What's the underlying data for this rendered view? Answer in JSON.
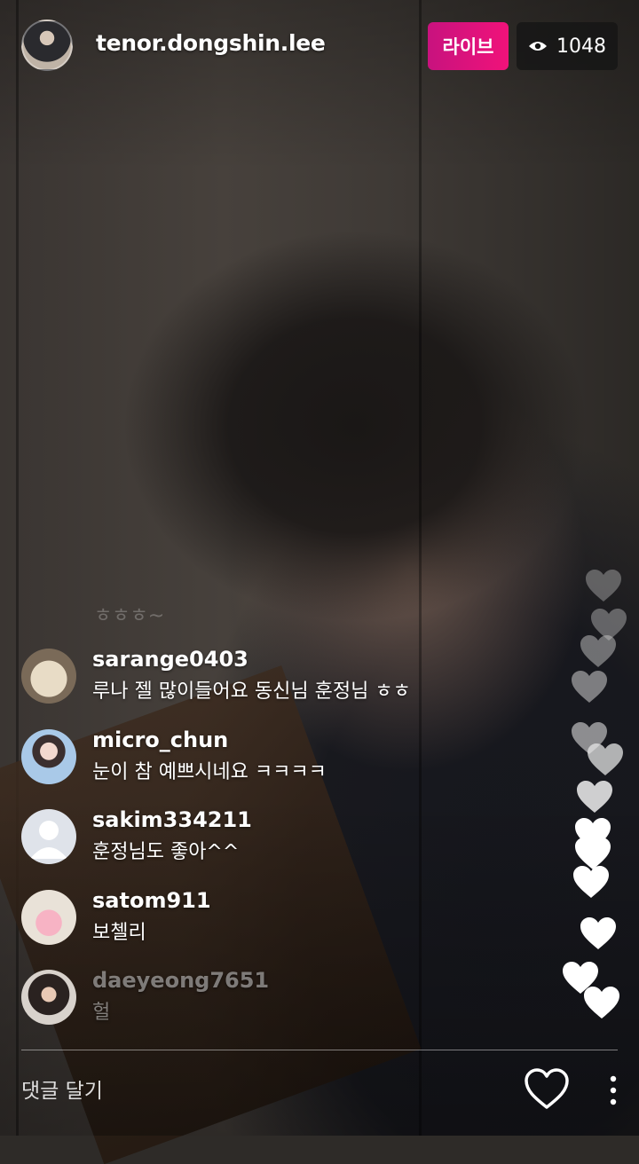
{
  "header": {
    "username": "tenor.dongshin.lee",
    "live_label": "라이브",
    "viewer_icon": "eye-icon",
    "viewer_count": "1048"
  },
  "faded_comment": "ㅎㅎㅎ~",
  "comments": [
    {
      "user": "sarange0403",
      "text": "루나 젤 많이들어요 동신님 훈정님 ㅎㅎ"
    },
    {
      "user": "micro_chun",
      "text": "눈이 참 예쁘시네요 ㅋㅋㅋㅋ"
    },
    {
      "user": "sakim334211",
      "text": "훈정님도 좋아^^"
    },
    {
      "user": "satom911",
      "text": "보첼리"
    },
    {
      "user": "daeyeong7651",
      "text": "헐"
    }
  ],
  "footer": {
    "comment_placeholder": "댓글 달기",
    "like_icon": "heart-outline-icon",
    "more_icon": "more-vertical-icon"
  }
}
